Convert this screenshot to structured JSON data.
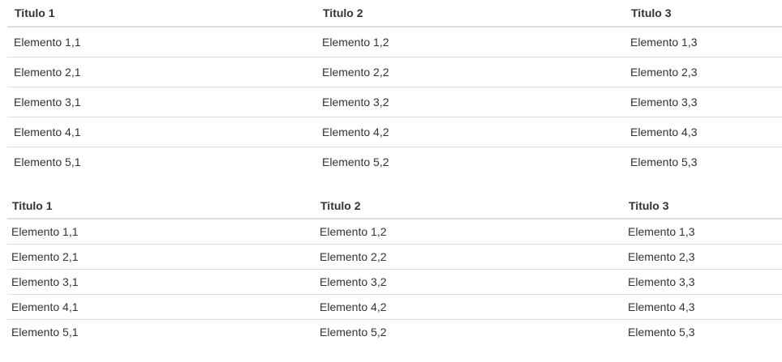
{
  "tables": [
    {
      "headers": [
        "Titulo 1",
        "Titulo 2",
        "Titulo 3"
      ],
      "rows": [
        [
          "Elemento 1,1",
          "Elemento 1,2",
          "Elemento 1,3"
        ],
        [
          "Elemento 2,1",
          "Elemento 2,2",
          "Elemento 2,3"
        ],
        [
          "Elemento 3,1",
          "Elemento 3,2",
          "Elemento 3,3"
        ],
        [
          "Elemento 4,1",
          "Elemento 4,2",
          "Elemento 4,3"
        ],
        [
          "Elemento 5,1",
          "Elemento 5,2",
          "Elemento 5,3"
        ]
      ]
    },
    {
      "headers": [
        "Titulo 1",
        "Titulo 2",
        "Titulo 3"
      ],
      "rows": [
        [
          "Elemento 1,1",
          "Elemento 1,2",
          "Elemento 1,3"
        ],
        [
          "Elemento 2,1",
          "Elemento 2,2",
          "Elemento 2,3"
        ],
        [
          "Elemento 3,1",
          "Elemento 3,2",
          "Elemento 3,3"
        ],
        [
          "Elemento 4,1",
          "Elemento 4,2",
          "Elemento 4,3"
        ],
        [
          "Elemento 5,1",
          "Elemento 5,2",
          "Elemento 5,3"
        ]
      ]
    }
  ],
  "colors": {
    "text": "#333333",
    "border": "#dddddd",
    "background": "#ffffff"
  }
}
